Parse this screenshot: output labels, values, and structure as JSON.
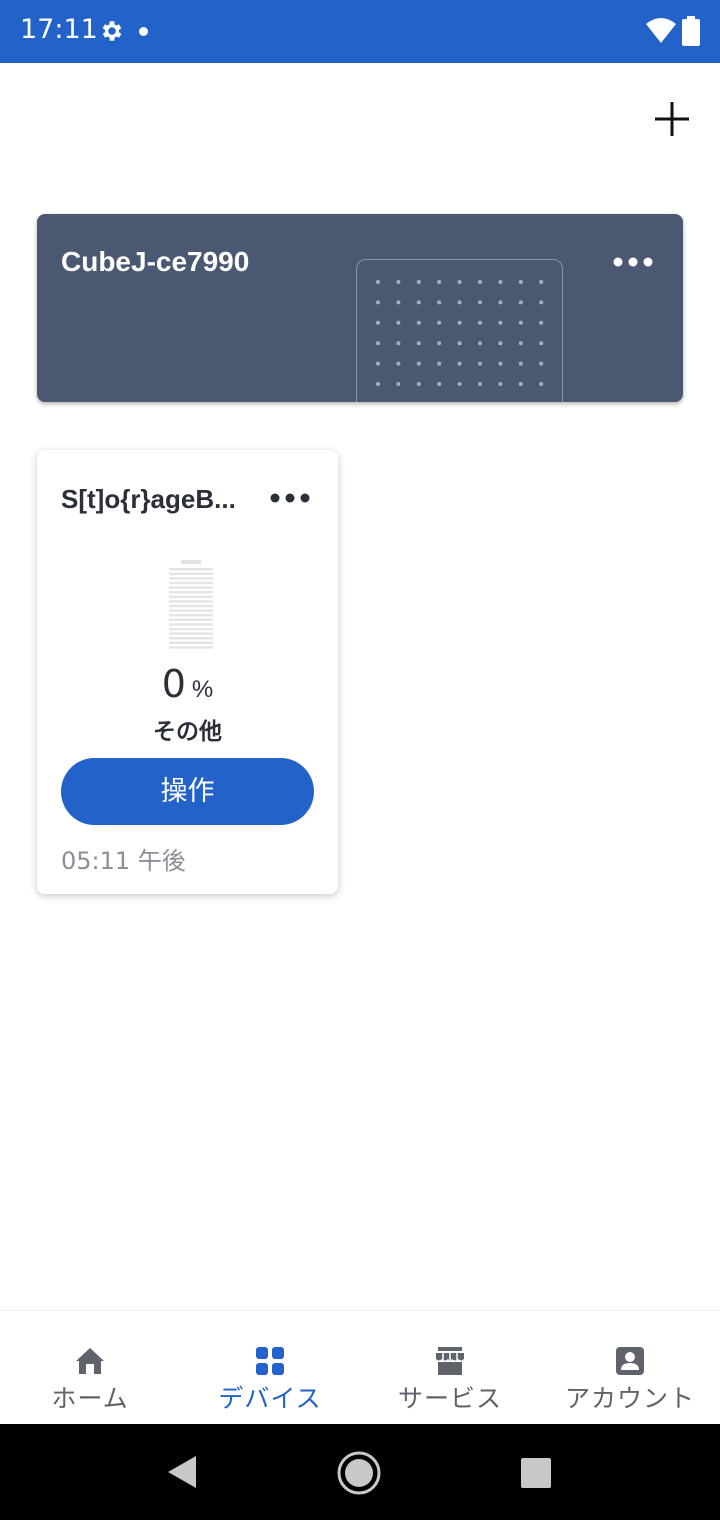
{
  "status_bar": {
    "time": "17:11",
    "icons": [
      "gear-icon",
      "notification-dot",
      "wifi-icon",
      "battery-icon"
    ]
  },
  "header": {
    "add_icon": "plus-icon"
  },
  "hub_card": {
    "name": "CubeJ-ce7990",
    "more_icon": "more-horizontal-icon",
    "background_color": "#4b5871"
  },
  "device_card": {
    "name": "S[t]o{r}ageB...",
    "more_icon": "more-horizontal-icon",
    "level": "0",
    "level_unit": "%",
    "level_fraction": 0,
    "type": "その他",
    "operate_label": "操作",
    "time": "05:11 午後"
  },
  "bottom_nav": {
    "items": [
      {
        "label": "ホーム",
        "icon": "home-icon",
        "active": false
      },
      {
        "label": "デバイス",
        "icon": "grid-icon",
        "active": true
      },
      {
        "label": "サービス",
        "icon": "store-icon",
        "active": false
      },
      {
        "label": "アカウント",
        "icon": "account-icon",
        "active": false
      }
    ]
  },
  "colors": {
    "accent": "#2362c9",
    "text_dark": "#2a2f3a",
    "text_muted": "#8a8f99"
  }
}
